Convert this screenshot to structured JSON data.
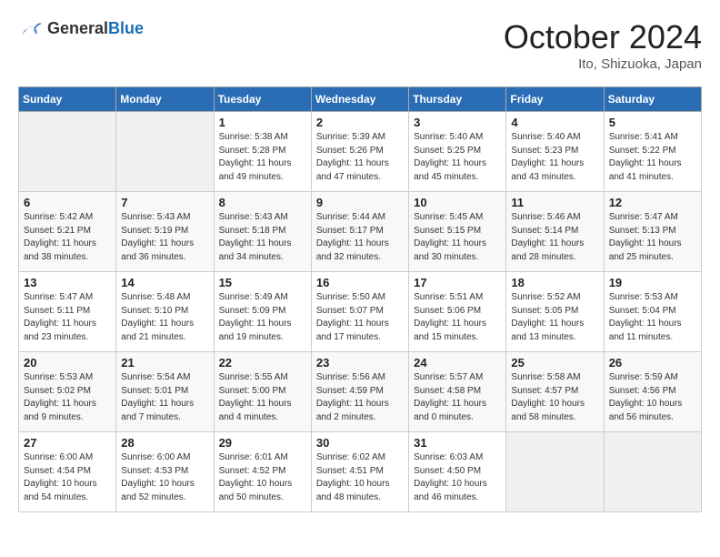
{
  "header": {
    "logo_general": "General",
    "logo_blue": "Blue",
    "title": "October 2024",
    "location": "Ito, Shizuoka, Japan"
  },
  "weekdays": [
    "Sunday",
    "Monday",
    "Tuesday",
    "Wednesday",
    "Thursday",
    "Friday",
    "Saturday"
  ],
  "weeks": [
    [
      {
        "day": "",
        "info": ""
      },
      {
        "day": "",
        "info": ""
      },
      {
        "day": "1",
        "info": "Sunrise: 5:38 AM\nSunset: 5:28 PM\nDaylight: 11 hours and 49 minutes."
      },
      {
        "day": "2",
        "info": "Sunrise: 5:39 AM\nSunset: 5:26 PM\nDaylight: 11 hours and 47 minutes."
      },
      {
        "day": "3",
        "info": "Sunrise: 5:40 AM\nSunset: 5:25 PM\nDaylight: 11 hours and 45 minutes."
      },
      {
        "day": "4",
        "info": "Sunrise: 5:40 AM\nSunset: 5:23 PM\nDaylight: 11 hours and 43 minutes."
      },
      {
        "day": "5",
        "info": "Sunrise: 5:41 AM\nSunset: 5:22 PM\nDaylight: 11 hours and 41 minutes."
      }
    ],
    [
      {
        "day": "6",
        "info": "Sunrise: 5:42 AM\nSunset: 5:21 PM\nDaylight: 11 hours and 38 minutes."
      },
      {
        "day": "7",
        "info": "Sunrise: 5:43 AM\nSunset: 5:19 PM\nDaylight: 11 hours and 36 minutes."
      },
      {
        "day": "8",
        "info": "Sunrise: 5:43 AM\nSunset: 5:18 PM\nDaylight: 11 hours and 34 minutes."
      },
      {
        "day": "9",
        "info": "Sunrise: 5:44 AM\nSunset: 5:17 PM\nDaylight: 11 hours and 32 minutes."
      },
      {
        "day": "10",
        "info": "Sunrise: 5:45 AM\nSunset: 5:15 PM\nDaylight: 11 hours and 30 minutes."
      },
      {
        "day": "11",
        "info": "Sunrise: 5:46 AM\nSunset: 5:14 PM\nDaylight: 11 hours and 28 minutes."
      },
      {
        "day": "12",
        "info": "Sunrise: 5:47 AM\nSunset: 5:13 PM\nDaylight: 11 hours and 25 minutes."
      }
    ],
    [
      {
        "day": "13",
        "info": "Sunrise: 5:47 AM\nSunset: 5:11 PM\nDaylight: 11 hours and 23 minutes."
      },
      {
        "day": "14",
        "info": "Sunrise: 5:48 AM\nSunset: 5:10 PM\nDaylight: 11 hours and 21 minutes."
      },
      {
        "day": "15",
        "info": "Sunrise: 5:49 AM\nSunset: 5:09 PM\nDaylight: 11 hours and 19 minutes."
      },
      {
        "day": "16",
        "info": "Sunrise: 5:50 AM\nSunset: 5:07 PM\nDaylight: 11 hours and 17 minutes."
      },
      {
        "day": "17",
        "info": "Sunrise: 5:51 AM\nSunset: 5:06 PM\nDaylight: 11 hours and 15 minutes."
      },
      {
        "day": "18",
        "info": "Sunrise: 5:52 AM\nSunset: 5:05 PM\nDaylight: 11 hours and 13 minutes."
      },
      {
        "day": "19",
        "info": "Sunrise: 5:53 AM\nSunset: 5:04 PM\nDaylight: 11 hours and 11 minutes."
      }
    ],
    [
      {
        "day": "20",
        "info": "Sunrise: 5:53 AM\nSunset: 5:02 PM\nDaylight: 11 hours and 9 minutes."
      },
      {
        "day": "21",
        "info": "Sunrise: 5:54 AM\nSunset: 5:01 PM\nDaylight: 11 hours and 7 minutes."
      },
      {
        "day": "22",
        "info": "Sunrise: 5:55 AM\nSunset: 5:00 PM\nDaylight: 11 hours and 4 minutes."
      },
      {
        "day": "23",
        "info": "Sunrise: 5:56 AM\nSunset: 4:59 PM\nDaylight: 11 hours and 2 minutes."
      },
      {
        "day": "24",
        "info": "Sunrise: 5:57 AM\nSunset: 4:58 PM\nDaylight: 11 hours and 0 minutes."
      },
      {
        "day": "25",
        "info": "Sunrise: 5:58 AM\nSunset: 4:57 PM\nDaylight: 10 hours and 58 minutes."
      },
      {
        "day": "26",
        "info": "Sunrise: 5:59 AM\nSunset: 4:56 PM\nDaylight: 10 hours and 56 minutes."
      }
    ],
    [
      {
        "day": "27",
        "info": "Sunrise: 6:00 AM\nSunset: 4:54 PM\nDaylight: 10 hours and 54 minutes."
      },
      {
        "day": "28",
        "info": "Sunrise: 6:00 AM\nSunset: 4:53 PM\nDaylight: 10 hours and 52 minutes."
      },
      {
        "day": "29",
        "info": "Sunrise: 6:01 AM\nSunset: 4:52 PM\nDaylight: 10 hours and 50 minutes."
      },
      {
        "day": "30",
        "info": "Sunrise: 6:02 AM\nSunset: 4:51 PM\nDaylight: 10 hours and 48 minutes."
      },
      {
        "day": "31",
        "info": "Sunrise: 6:03 AM\nSunset: 4:50 PM\nDaylight: 10 hours and 46 minutes."
      },
      {
        "day": "",
        "info": ""
      },
      {
        "day": "",
        "info": ""
      }
    ]
  ]
}
